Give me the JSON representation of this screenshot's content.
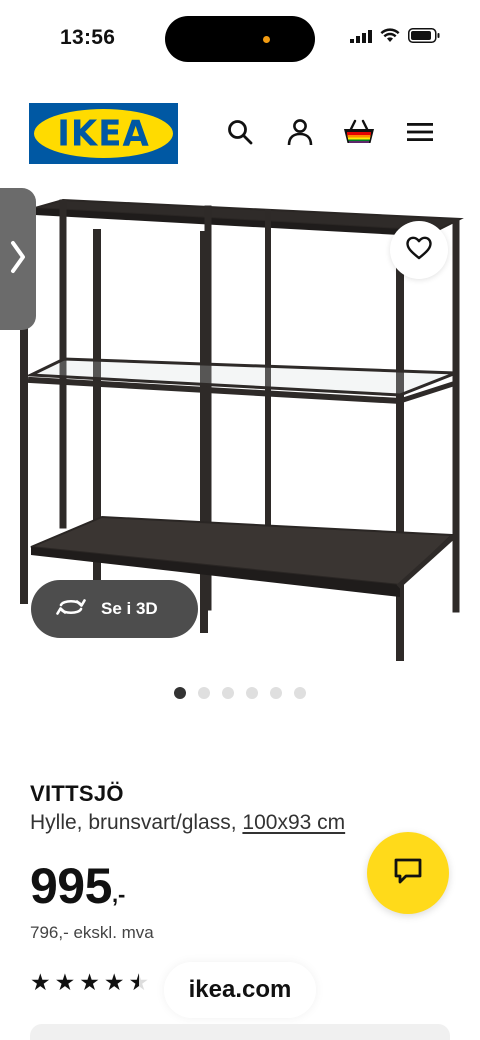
{
  "status_bar": {
    "time": "13:56",
    "icons": [
      "signal-icon",
      "wifi-icon",
      "battery-icon"
    ]
  },
  "header": {
    "logo_text": "IKEA",
    "icons": [
      "search-icon",
      "user-icon",
      "basket-icon",
      "menu-icon"
    ]
  },
  "gallery": {
    "view_3d_label": "Se i 3D",
    "slide_count": 6,
    "active_slide": 1
  },
  "product": {
    "name": "VITTSJÖ",
    "description": "Hylle, brunsvart/glass,",
    "size": "100x93 cm",
    "price_main": "995",
    "price_suffix": ",-",
    "price_ex_vat": "796,- ekskl. mva",
    "rating": 4.5,
    "rating_max": 5
  },
  "browser": {
    "url": "ikea.com"
  },
  "colors": {
    "ikea_blue": "#0058a3",
    "ikea_yellow": "#ffdb00",
    "chat_yellow": "#ffda1a"
  }
}
